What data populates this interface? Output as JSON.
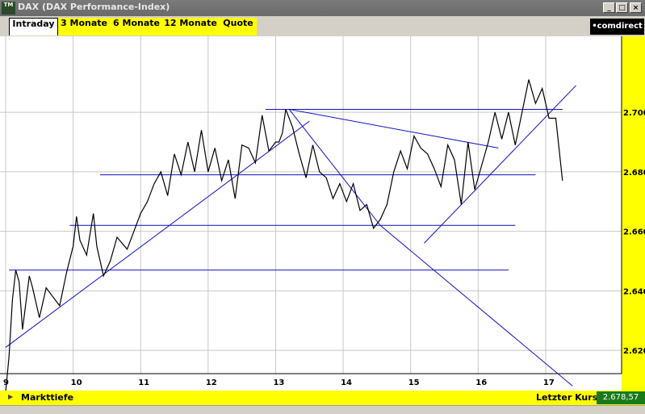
{
  "window": {
    "title": "DAX (DAX Performance-Index)",
    "icon_label": "TM",
    "buttons": [
      "_",
      "□",
      "×"
    ]
  },
  "tabs": [
    "Intraday",
    "3 Monate",
    "6 Monate",
    "12 Monate",
    "Quote"
  ],
  "active_tab": "Intraday",
  "brand": "•comdirect",
  "bottom": {
    "arrow_icon": "triangle-right-icon",
    "left_label": "Markttiefe",
    "right_label": "Letzter Kurs",
    "value": "2.678,57"
  },
  "colors": {
    "accent": "#ffff00",
    "trendlines": "#1010c0",
    "price": "#000000",
    "value_box": "#1a7a1a",
    "baseline": "#e8e800"
  },
  "chart_data": {
    "type": "line",
    "x_ticks": [
      "9",
      "10",
      "11",
      "12",
      "13",
      "14",
      "15",
      "16",
      "17"
    ],
    "y_ticks": [
      "2.620",
      "2.640",
      "2.660",
      "2.680",
      "2.700"
    ],
    "xlim": [
      9,
      18
    ],
    "ylim": [
      2610,
      2722
    ],
    "grid": true,
    "baseline": 2606,
    "series": [
      {
        "x": [
          9.0,
          9.05,
          9.1,
          9.15,
          9.2,
          9.25,
          9.35,
          9.4,
          9.5,
          9.6,
          9.7,
          9.8,
          9.9,
          10.0,
          10.05,
          10.1,
          10.2,
          10.3,
          10.35,
          10.45,
          10.55,
          10.65,
          10.8,
          10.9,
          11.0,
          11.1,
          11.2,
          11.3,
          11.4,
          11.5,
          11.6,
          11.7,
          11.8,
          11.9,
          12.0,
          12.1,
          12.2,
          12.3,
          12.4,
          12.5,
          12.6,
          12.7,
          12.8,
          12.9,
          13.0,
          13.05,
          13.1,
          13.15,
          13.25,
          13.35,
          13.45,
          13.55,
          13.65,
          13.75,
          13.85,
          13.95,
          14.05,
          14.15,
          14.25,
          14.35,
          14.45,
          14.55,
          14.65,
          14.75,
          14.85,
          14.95,
          15.05,
          15.15,
          15.25,
          15.35,
          15.45,
          15.55,
          15.65,
          15.75,
          15.85,
          15.95,
          16.05,
          16.15,
          16.25,
          16.35,
          16.45,
          16.55,
          16.65,
          16.75,
          16.85,
          16.95,
          17.05,
          17.15,
          17.25
        ],
        "y": [
          2606,
          2618,
          2637,
          2647,
          2643,
          2627,
          2645,
          2641,
          2631,
          2641,
          2638,
          2635,
          2646,
          2655,
          2665,
          2657,
          2652,
          2666,
          2655,
          2645,
          2650,
          2658,
          2654,
          2660,
          2666,
          2670,
          2676,
          2680,
          2672,
          2686,
          2679,
          2690,
          2680,
          2694,
          2680,
          2688,
          2677,
          2684,
          2671,
          2689,
          2688,
          2683,
          2699,
          2687,
          2690,
          2690,
          2693,
          2701,
          2695,
          2686,
          2678,
          2689,
          2680,
          2678,
          2671,
          2676,
          2670,
          2676,
          2667,
          2669,
          2661,
          2664,
          2669,
          2680,
          2687,
          2681,
          2692,
          2688,
          2686,
          2681,
          2675,
          2689,
          2684,
          2669,
          2690,
          2674,
          2682,
          2690,
          2700,
          2691,
          2700,
          2689,
          2700,
          2711,
          2703,
          2708,
          2698,
          2698,
          2677
        ]
      }
    ],
    "trendlines": [
      {
        "from": [
          9.0,
          2621
        ],
        "to": [
          13.5,
          2697
        ]
      },
      {
        "from": [
          13.2,
          2701
        ],
        "to": [
          14.55,
          2662
        ]
      },
      {
        "from": [
          14.55,
          2662
        ],
        "to": [
          17.4,
          2608
        ]
      },
      {
        "from": [
          13.2,
          2701
        ],
        "to": [
          16.3,
          2688
        ]
      },
      {
        "from": [
          15.2,
          2656
        ],
        "to": [
          17.45,
          2709
        ]
      },
      {
        "from": [
          12.85,
          2701
        ],
        "to": [
          17.25,
          2701
        ]
      },
      {
        "from": [
          10.4,
          2679
        ],
        "to": [
          16.85,
          2679
        ]
      },
      {
        "from": [
          9.95,
          2662
        ],
        "to": [
          16.55,
          2662
        ]
      },
      {
        "from": [
          9.05,
          2647
        ],
        "to": [
          16.45,
          2647
        ]
      }
    ]
  }
}
